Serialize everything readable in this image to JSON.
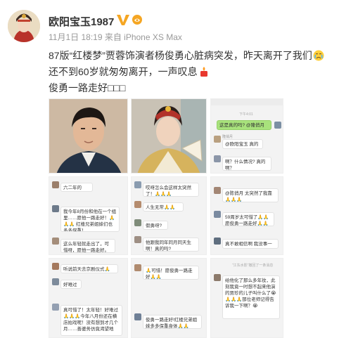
{
  "post": {
    "username": "欧阳宝玉1987",
    "meta": "11月1日 18:19 来自 iPhone XS Max",
    "lines": [
      "87版“红楼梦”贾蓉饰演者杨俊勇心脏病突发，昨天离开了我们",
      "还不到60岁就匆匆离开，一声叹息",
      "俊勇一路走好□□□"
    ]
  },
  "icons": {
    "verified": "verified-v-icon",
    "vip": "vip-badge-icon",
    "cry": "crying-emoji-icon",
    "candle": "candle-emoji-icon"
  },
  "chats": {
    "t3_a": "这是真的吗? @隆俏月",
    "t3_b": "@欧阳宝玉 真的",
    "t3_c": "啊？什么情况? 真的啊？",
    "t4_a": "六二年的",
    "t5_a": "哎呀怎么会这样太突然了！🙏🙏🙏",
    "t5_b": "人生无常🙏🙏🙏",
    "t5_c": "假勇呀?",
    "t5_d": "他跟我同年同月同天生啊！真的吗?",
    "t6_a": "@陈俏月 太突然了我靠🙏🙏🙏",
    "t6_b": "59周岁太可惜了🙏🙏 愿俊勇一路走好🙏🙏🙏",
    "t6_c": "真不敢相信啊 我没事一",
    "t7_a": "我今年8月份和他在一个组里……愿他一路走好！🙏🙏🙏 红楼兄弟姐妹们也多多保重！",
    "t7_b": "这么年轻就走出了，可惜呀，愿他一路走好。",
    "t7_c": "听说前天去京剧仪式🙏🙏🙏",
    "t7_d": "好难过",
    "t8_a": "🙏可惜！愿俊勇一路走好🙏🙏",
    "t8_b": "俊勇一路走好!红楼兄弟姐妹多多保重身体🙏🙏",
    "t9_a": "“江东水影”撤回了一条消息",
    "t9_b": "给他化了那么多年妆，此刻我竟一时想不起来他演的贾珍的儿子叫什么了😭🙏🙏🙏那位老师记得告诉我一下啊？😭",
    "t10_a": "真可惜了！太年轻！好难过🙏🙏🙏今年八月份还在横店拍戏呢！没有想到才几个月……善婆务仿竟渴望地"
  }
}
